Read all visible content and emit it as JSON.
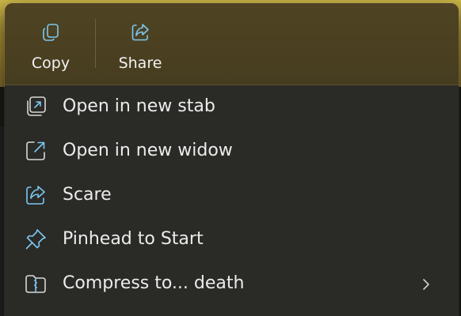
{
  "quick_actions": {
    "copy_label": "Copy",
    "share_label": "Share"
  },
  "menu_items": [
    {
      "label": "Open in new stab",
      "icon": "open-new-tab-icon"
    },
    {
      "label": "Open in new widow",
      "icon": "open-new-window-icon"
    },
    {
      "label": "Scare",
      "icon": "share-icon"
    },
    {
      "label": "Pinhead to Start",
      "icon": "pin-icon"
    },
    {
      "label": "Compress to... death",
      "icon": "zip-folder-icon",
      "has_submenu": true
    }
  ],
  "colors": {
    "accent": "#7cc7f2",
    "menu_background": "#2a2a27",
    "quickbar_background": "#4b4021",
    "text": "#ececec"
  }
}
